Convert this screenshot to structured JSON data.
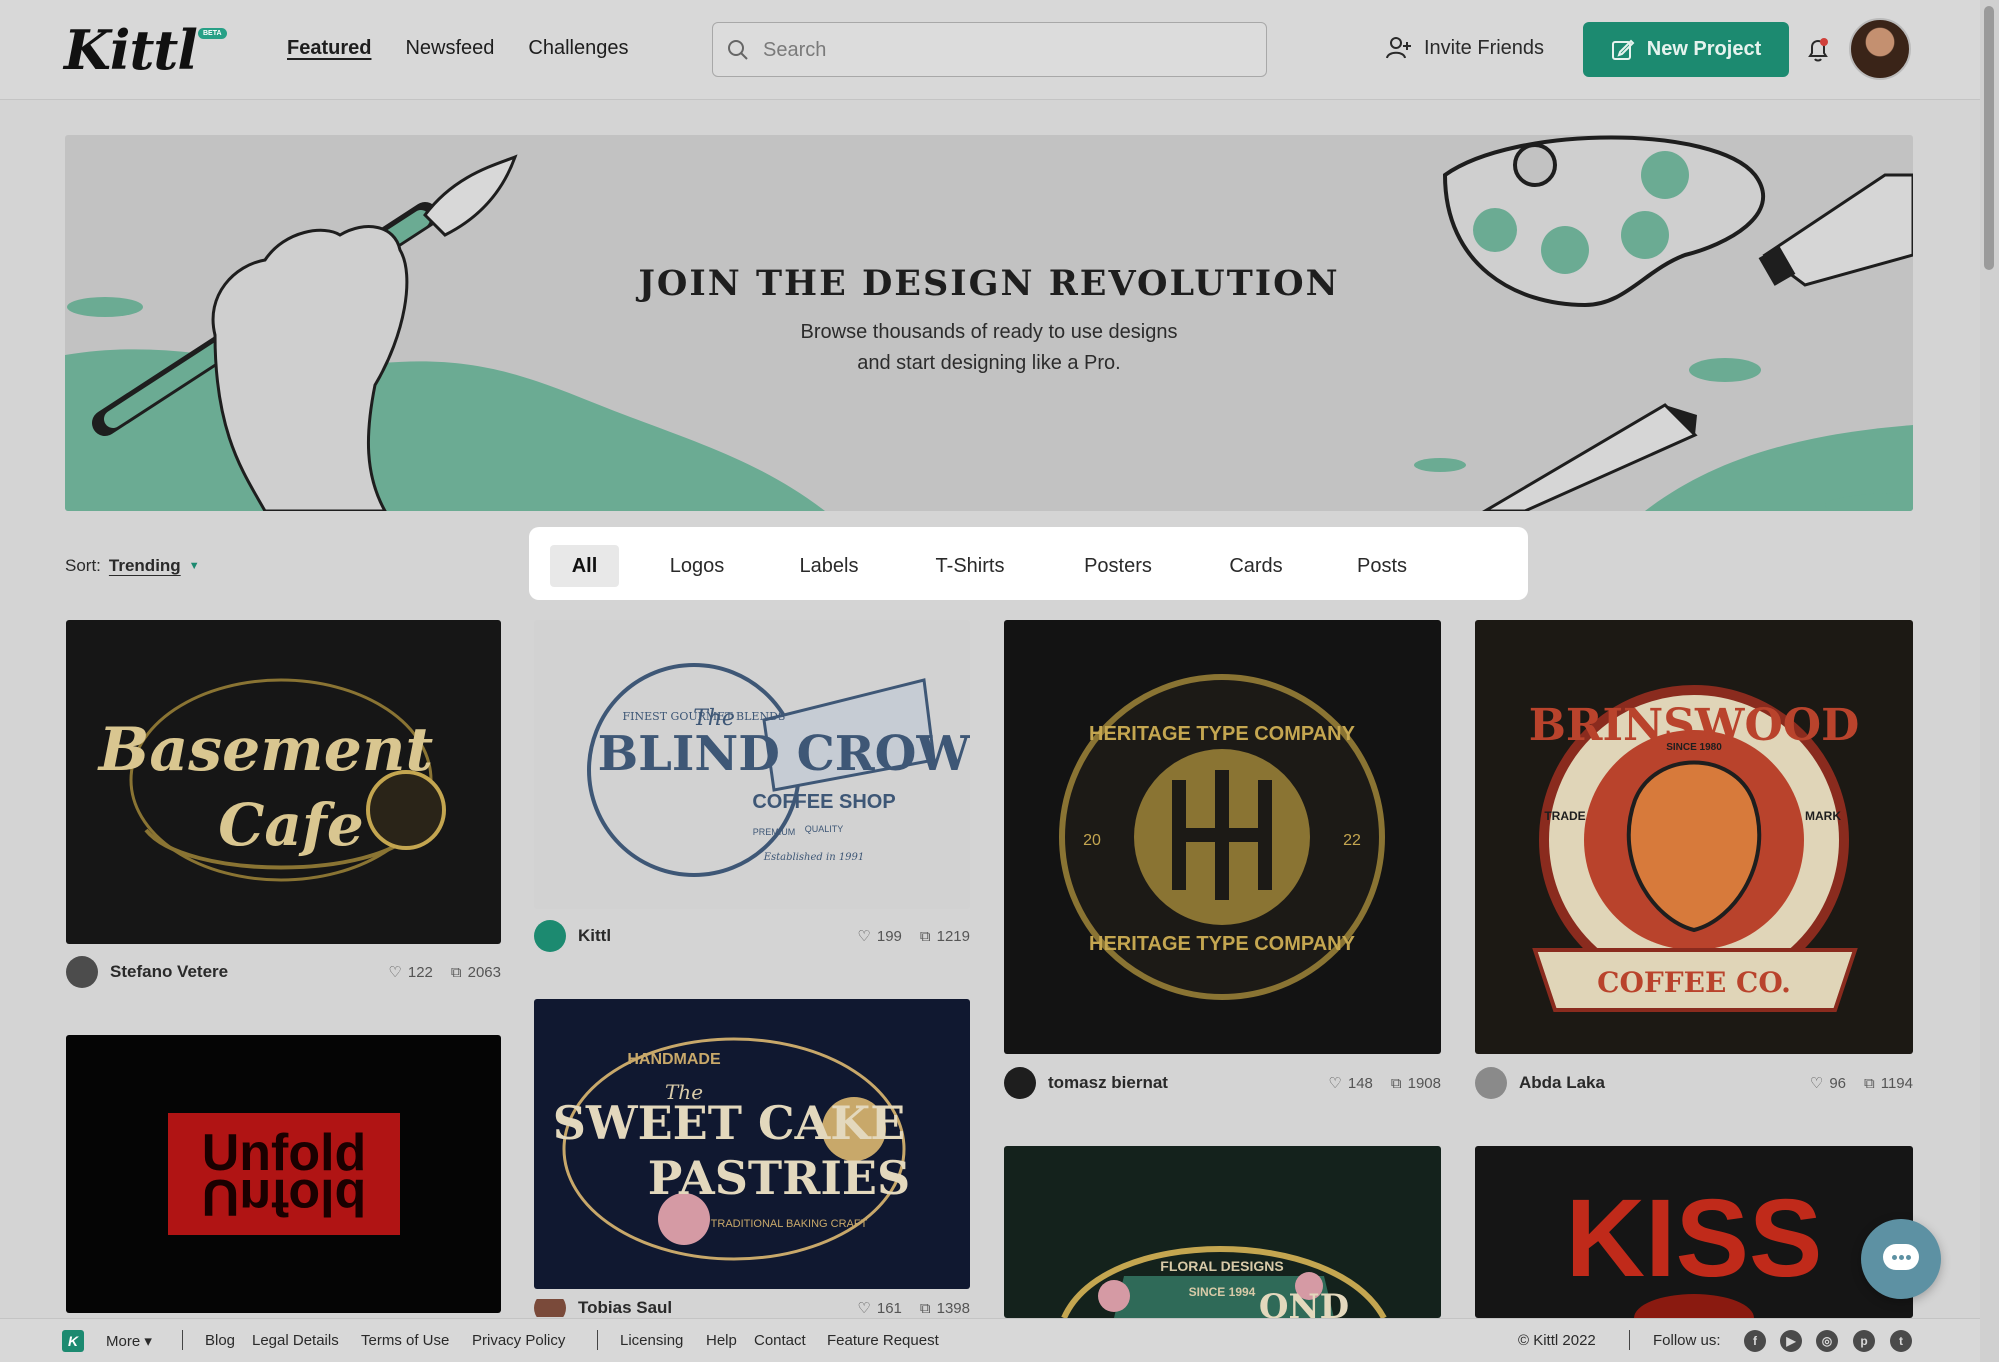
{
  "header": {
    "logo": "Kittl",
    "beta_badge": "BETA",
    "nav": [
      {
        "label": "Featured"
      },
      {
        "label": "Newsfeed"
      },
      {
        "label": "Challenges"
      }
    ],
    "search_placeholder": "Search",
    "invite_label": "Invite Friends",
    "new_project_label": "New Project",
    "accent_color": "#1c8a70"
  },
  "hero": {
    "title": "JOIN THE DESIGN REVOLUTION",
    "line1": "Browse thousands of ready to use designs",
    "line2": "and start designing like a Pro."
  },
  "sort": {
    "label": "Sort:",
    "value": "Trending"
  },
  "tabs": [
    "All",
    "Logos",
    "Labels",
    "T-Shirts",
    "Posters",
    "Cards",
    "Posts"
  ],
  "cards": [
    {
      "title": "Basement Cafe",
      "author": "Stefano Vetere",
      "likes": "122",
      "copies": "2063"
    },
    {
      "title": "Unfold",
      "author": "",
      "likes": "",
      "copies": ""
    },
    {
      "title": "The Blind Crow Coffee Shop",
      "author": "Kittl",
      "likes": "199",
      "copies": "1219"
    },
    {
      "title": "The Sweet Cake Pastries",
      "author": "Tobias Saul",
      "likes": "161",
      "copies": "1398"
    },
    {
      "title": "Heritage Type Company",
      "author": "tomasz biernat",
      "likes": "148",
      "copies": "1908"
    },
    {
      "title": "Floral Designs",
      "author": "",
      "likes": "",
      "copies": ""
    },
    {
      "title": "Brinswood Coffee Co.",
      "author": "Abda Laka",
      "likes": "96",
      "copies": "1194"
    },
    {
      "title": "KISS",
      "author": "",
      "likes": "",
      "copies": ""
    }
  ],
  "art_text": {
    "basement": [
      "Basement",
      "Cafe"
    ],
    "blindcrow": [
      "The",
      "BLIND CROW",
      "COFFEE SHOP",
      "FINEST GOURMET BLENDS",
      "PREMIUM",
      "QUALITY",
      "Established in 1991"
    ],
    "heritage": [
      "HERITAGE TYPE COMPANY",
      "HERITAGE TYPE COMPANY",
      "20",
      "22"
    ],
    "brinswood": [
      "BRINSWOOD",
      "SINCE 1980",
      "TRADE",
      "MARK",
      "COFFEE CO."
    ],
    "unfold": "Unfold",
    "sweetcake": [
      "HANDMADE",
      "The",
      "SWEET CAKE",
      "PASTRIES",
      "TRADITIONAL BAKING CRAFT"
    ],
    "floral": [
      "FLORAL DESIGNS",
      "SINCE 1994",
      "OND"
    ],
    "kiss": "KISS"
  },
  "footer": {
    "logo": "K",
    "more": "More",
    "links": [
      "Blog",
      "Legal Details",
      "Terms of Use",
      "Privacy Policy",
      "Licensing",
      "Help",
      "Contact",
      "Feature Request"
    ],
    "copyright": "© Kittl 2022",
    "follow": "Follow us:",
    "socials": [
      "facebook-icon",
      "youtube-icon",
      "instagram-icon",
      "pinterest-icon",
      "twitter-icon"
    ]
  }
}
